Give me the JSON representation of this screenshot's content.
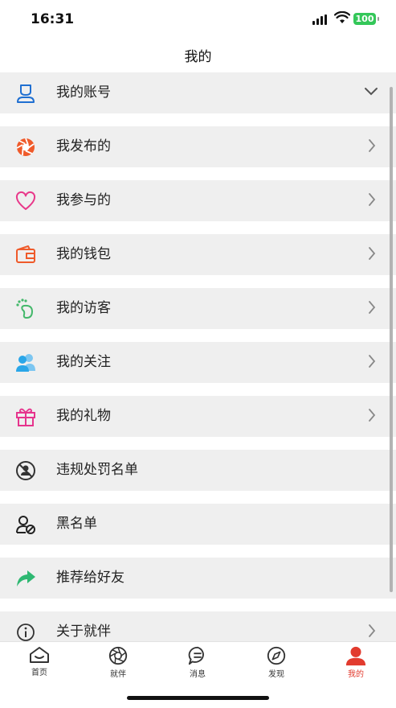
{
  "status": {
    "time": "16:31",
    "battery": "100"
  },
  "header": {
    "title": "我的"
  },
  "menu": {
    "items": [
      {
        "label": "我的账号",
        "icon": "user-account-icon",
        "chevron": "down"
      },
      {
        "label": "我发布的",
        "icon": "shutter-icon",
        "chevron": "right"
      },
      {
        "label": "我参与的",
        "icon": "heart-icon",
        "chevron": "right"
      },
      {
        "label": "我的钱包",
        "icon": "wallet-icon",
        "chevron": "right"
      },
      {
        "label": "我的访客",
        "icon": "footprint-icon",
        "chevron": "right"
      },
      {
        "label": "我的关注",
        "icon": "users-icon",
        "chevron": "right"
      },
      {
        "label": "我的礼物",
        "icon": "gift-icon",
        "chevron": "right"
      },
      {
        "label": "违规处罚名单",
        "icon": "violation-icon",
        "chevron": "none"
      },
      {
        "label": "黑名单",
        "icon": "blacklist-icon",
        "chevron": "none"
      },
      {
        "label": "推荐给好友",
        "icon": "share-arrow-icon",
        "chevron": "none"
      },
      {
        "label": "关于就伴",
        "icon": "info-icon",
        "chevron": "right"
      }
    ]
  },
  "tabbar": {
    "items": [
      {
        "label": "首页",
        "icon": "home-icon"
      },
      {
        "label": "就伴",
        "icon": "shutter-icon"
      },
      {
        "label": "消息",
        "icon": "message-icon"
      },
      {
        "label": "发现",
        "icon": "compass-icon"
      },
      {
        "label": "我的",
        "icon": "profile-icon",
        "active": true
      }
    ]
  },
  "colors": {
    "accent": "#e23b2e",
    "menu_bg": "#efefef",
    "account_blue": "#1f6fd1",
    "share_green": "#2eb872",
    "heart_pink": "#e8388a",
    "wallet_orange": "#ef5a2a",
    "footprint_green": "#44b86b",
    "users_blue": "#2aa6e8",
    "gift_pink": "#e6348d"
  }
}
